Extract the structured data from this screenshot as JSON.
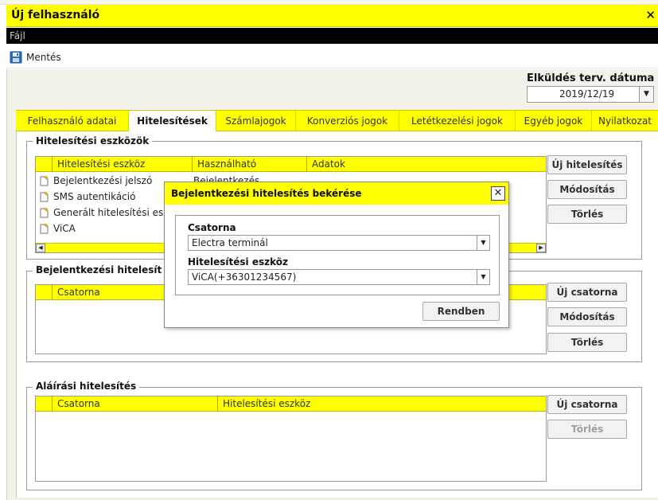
{
  "window": {
    "title": "Új felhasználó",
    "close_symbol": "✕"
  },
  "menu": {
    "items": [
      "Fájl"
    ]
  },
  "toolbar": {
    "save_label": "Mentés",
    "save_icon": "floppy-disk-icon"
  },
  "send_date": {
    "label": "Elküldés terv. dátuma",
    "value": "2019/12/19"
  },
  "tabs": [
    {
      "label": "Felhasználó adatai",
      "active": false
    },
    {
      "label": "Hitelesítések",
      "active": true
    },
    {
      "label": "Számlajogok",
      "active": false
    },
    {
      "label": "Konverziós jogok",
      "active": false
    },
    {
      "label": "Letétkezelési jogok",
      "active": false
    },
    {
      "label": "Egyéb jogok",
      "active": false
    },
    {
      "label": "Nyilatkozat",
      "active": false
    }
  ],
  "auth_tools": {
    "title": "Hitelesítési eszközök",
    "columns": [
      "Hitelesítési eszköz",
      "Használható",
      "Adatok"
    ],
    "rows": [
      {
        "name": "Bejelentkezési jelszó",
        "usable": "Bejelentkezés"
      },
      {
        "name": "SMS autentikáció",
        "usable": ""
      },
      {
        "name": "Generált hitelesítési esz",
        "usable": ""
      },
      {
        "name": "ViCA",
        "usable": ""
      }
    ],
    "buttons": {
      "new": "Új hitelesítés",
      "edit": "Módosítás",
      "delete": "Törlés"
    }
  },
  "login_auth": {
    "title": "Bejelentkezési hitelesít",
    "columns": [
      "Csatorna"
    ],
    "buttons": {
      "new": "Új csatorna",
      "edit": "Módosítás",
      "delete": "Törlés"
    }
  },
  "sign_auth": {
    "title": "Aláírási hitelesítés",
    "columns": [
      "Csatorna",
      "Hitelesítési eszköz"
    ],
    "buttons": {
      "new": "Új csatorna",
      "delete": "Törlés"
    }
  },
  "dialog": {
    "title": "Bejelentkezési hitelesítés bekérése",
    "close_symbol": "✕",
    "channel_label": "Csatorna",
    "channel_value": "Electra terminál",
    "device_label": "Hitelesítési eszköz",
    "device_value": "ViCA(+36301234567)",
    "ok_label": "Rendben"
  },
  "colors": {
    "accent": "#ffff00",
    "menu_bg": "#000000",
    "panel_bg": "#f2f2ea"
  }
}
